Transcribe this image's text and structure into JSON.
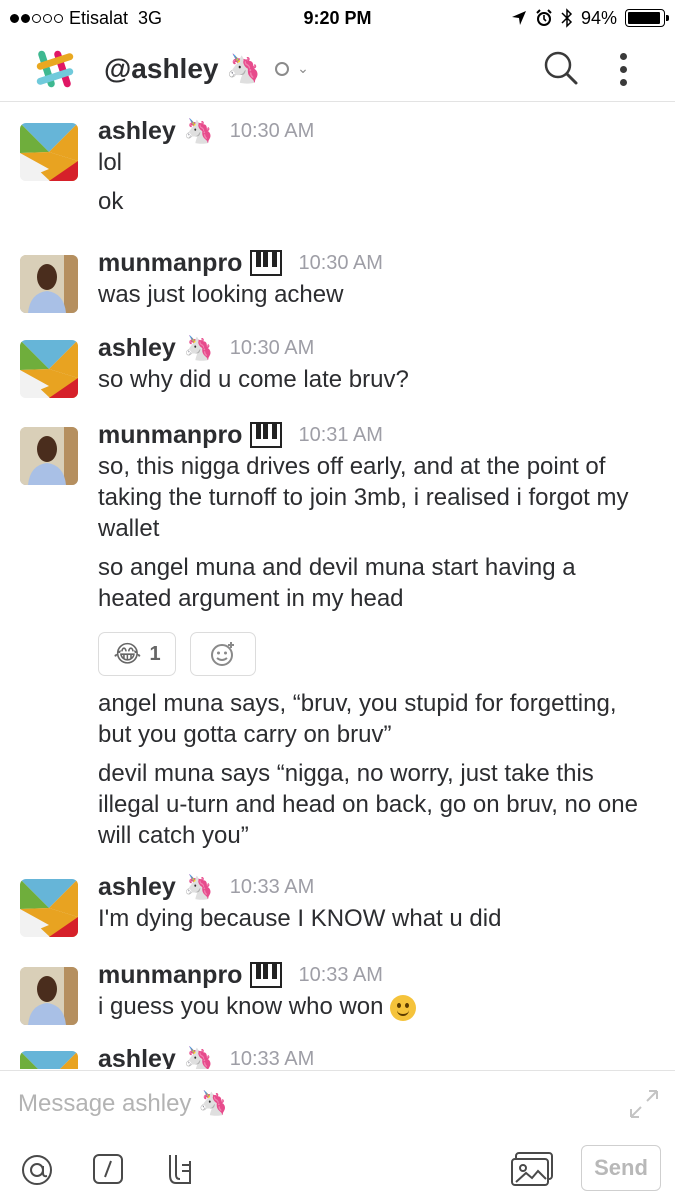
{
  "status_bar": {
    "carrier": "Etisalat",
    "network": "3G",
    "time": "9:20 PM",
    "battery": "94%",
    "battery_level": 0.94
  },
  "header": {
    "title": "@ashley",
    "title_emoji": "🦄"
  },
  "messages": [
    {
      "user": "ashley",
      "emoji": "🦄",
      "time": "10:30 AM",
      "lines": [
        "lol",
        "ok"
      ]
    },
    {
      "user": "munmanpro",
      "emoji": "piano-icon",
      "time": "10:30 AM",
      "lines": [
        "was just looking achew"
      ]
    },
    {
      "user": "ashley",
      "emoji": "🦄",
      "time": "10:30 AM",
      "lines": [
        "so why did u come late bruv?"
      ]
    },
    {
      "user": "munmanpro",
      "emoji": "piano-icon",
      "time": "10:31 AM",
      "lines": [
        "so, this nigga drives off early, and at the point of taking the turnoff to join 3mb, i realised i forgot my wallet",
        "so angel muna and devil muna start having a heated argument in my head"
      ],
      "reaction": {
        "emoji": "😂",
        "count": "1"
      },
      "lines_after": [
        "angel muna says, “bruv, you stupid for forgetting, but you gotta carry on bruv”",
        "devil muna says “nigga, no worry, just take this illegal u-turn and head on back, go on bruv, no one will catch you”"
      ]
    },
    {
      "user": "ashley",
      "emoji": "🦄",
      "time": "10:33 AM",
      "lines": [
        "I'm dying because I KNOW what u did"
      ]
    },
    {
      "user": "munmanpro",
      "emoji": "piano-icon",
      "time": "10:33 AM",
      "lines": [
        "i guess you know who won"
      ]
    },
    {
      "user": "ashley",
      "emoji": "🦄",
      "time": "10:33 AM",
      "lines": []
    }
  ],
  "composer": {
    "placeholder": "Message ashley 🦄",
    "send_label": "Send"
  },
  "colors": {
    "text": "#2c2d30",
    "timestamp": "#9e9ea6",
    "border": "#e3e3e3"
  }
}
